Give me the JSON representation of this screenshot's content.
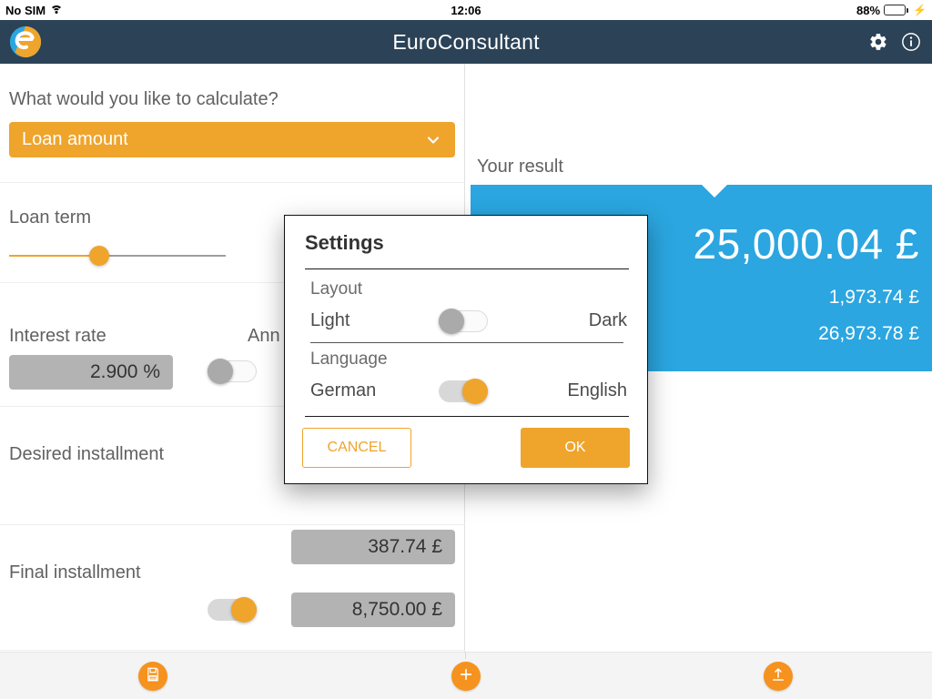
{
  "colors": {
    "accent_orange": "#efa42c",
    "fab_orange": "#f6921e",
    "appbar_navy": "#2b4257",
    "result_blue": "#2ba6e0",
    "field_grey": "#b3b3b3"
  },
  "status_bar": {
    "carrier": "No SIM",
    "wifi_icon": "wifi-icon",
    "time": "12:06",
    "battery_percent": "88%",
    "battery_icon": "battery-icon",
    "charging_icon": "lightning-bolt-icon"
  },
  "app_bar": {
    "logo_icon": "app-logo-icon",
    "title": "EuroConsultant",
    "settings_icon": "gear-icon",
    "info_icon": "info-icon"
  },
  "left_pane": {
    "calculate_question": "What would you like to calculate?",
    "calculate_dropdown": {
      "selected": "Loan amount",
      "chevron_icon": "chevron-down-icon"
    },
    "loan_term": {
      "label": "Loan term",
      "slider_fill_percent": 41
    },
    "interest_rate": {
      "label": "Interest rate",
      "secondary_label": "Ann",
      "value": "2.900 %",
      "toggle_state": "off"
    },
    "desired_installment": {
      "label": "Desired installment",
      "value": "387.74 £"
    },
    "final_installment": {
      "label": "Final installment",
      "value": "8,750.00 £",
      "toggle_state": "on"
    }
  },
  "right_pane": {
    "result_label": "Your result",
    "result_main": "25,000.04 £",
    "result_sub1": "1,973.74 £",
    "result_sub2": "26,973.78 £"
  },
  "bottom_bar": {
    "save_icon": "floppy-disk-save-icon",
    "add_icon": "plus-add-icon",
    "share_icon": "upload-share-icon"
  },
  "settings_dialog": {
    "title": "Settings",
    "layout": {
      "group_label": "Layout",
      "option_left": "Light",
      "option_right": "Dark",
      "toggle_state": "off"
    },
    "language": {
      "group_label": "Language",
      "option_left": "German",
      "option_right": "English",
      "toggle_state": "on"
    },
    "cancel_label": "CANCEL",
    "ok_label": "OK"
  }
}
